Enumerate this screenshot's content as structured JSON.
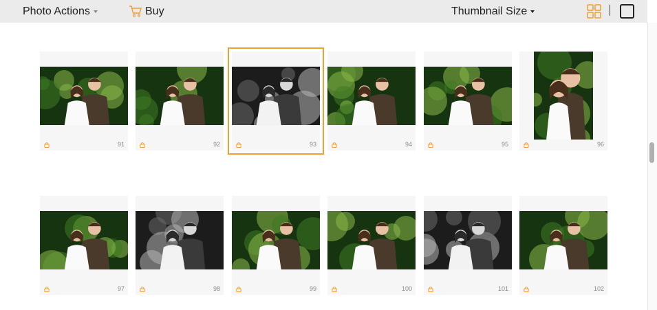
{
  "toolbar": {
    "photo_actions_label": "Photo Actions",
    "buy_label": "Buy",
    "thumbnail_size_label": "Thumbnail Size"
  },
  "colors": {
    "accent": "#f0a030",
    "topbar_bg": "#ebebeb",
    "tile_bg": "#f6f6f6"
  },
  "photos": [
    {
      "number": "91",
      "locked": true,
      "orientation": "landscape",
      "tone": "color"
    },
    {
      "number": "92",
      "locked": true,
      "orientation": "landscape",
      "tone": "color"
    },
    {
      "number": "93",
      "locked": true,
      "orientation": "landscape",
      "tone": "bw",
      "selected": true
    },
    {
      "number": "94",
      "locked": true,
      "orientation": "landscape",
      "tone": "color"
    },
    {
      "number": "95",
      "locked": true,
      "orientation": "landscape",
      "tone": "color"
    },
    {
      "number": "96",
      "locked": true,
      "orientation": "portrait",
      "tone": "color"
    },
    {
      "number": "97",
      "locked": true,
      "orientation": "landscape",
      "tone": "color"
    },
    {
      "number": "98",
      "locked": true,
      "orientation": "landscape",
      "tone": "bw"
    },
    {
      "number": "99",
      "locked": true,
      "orientation": "landscape",
      "tone": "color"
    },
    {
      "number": "100",
      "locked": true,
      "orientation": "landscape",
      "tone": "color"
    },
    {
      "number": "101",
      "locked": true,
      "orientation": "landscape",
      "tone": "bw"
    },
    {
      "number": "102",
      "locked": true,
      "orientation": "landscape",
      "tone": "color"
    }
  ]
}
